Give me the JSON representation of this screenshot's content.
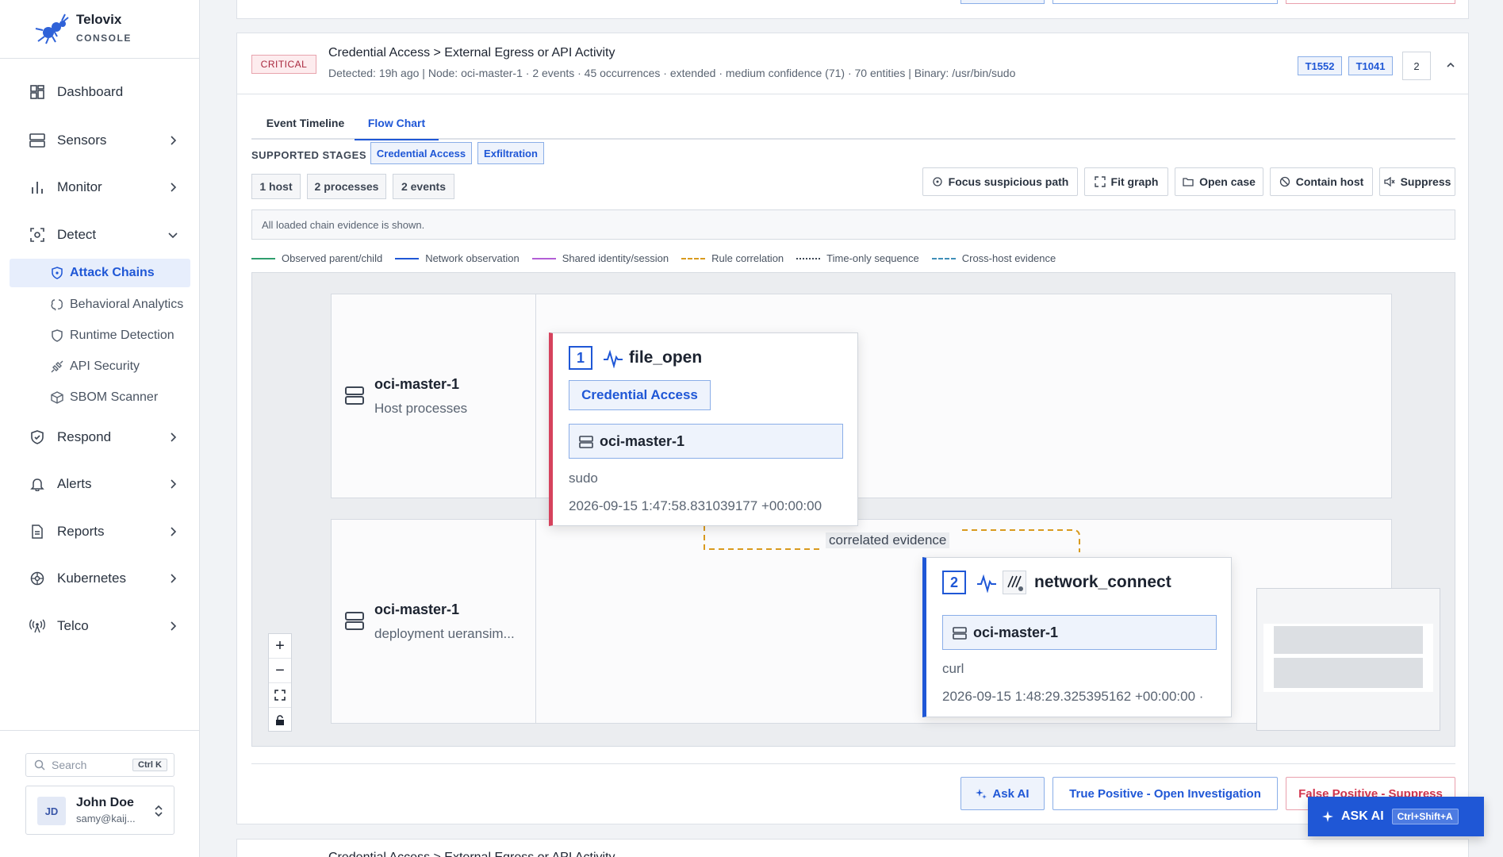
{
  "brand": {
    "name": "Telovix",
    "sub": "CONSOLE"
  },
  "nav": {
    "dashboard": "Dashboard",
    "sensors": "Sensors",
    "monitor": "Monitor",
    "detect": "Detect",
    "detect_sub": [
      "Attack Chains",
      "Behavioral Analytics",
      "Runtime Detection",
      "API Security",
      "SBOM Scanner"
    ],
    "respond": "Respond",
    "alerts": "Alerts",
    "reports": "Reports",
    "kubernetes": "Kubernetes",
    "telco": "Telco"
  },
  "search": {
    "placeholder": "Search",
    "shortcut": "Ctrl K"
  },
  "user": {
    "initials": "JD",
    "name": "John Doe",
    "email": "samy@kaij..."
  },
  "alert": {
    "severity": "CRITICAL",
    "title": "Credential Access > External Egress or API Activity",
    "meta": "Detected: 19h ago | Node: oci-master-1 · 2 events · 45 occurrences · extended · medium confidence (71) · 70 entities | Binary: /usr/bin/sudo",
    "techniques": [
      "T1552",
      "T1041"
    ],
    "count": "2"
  },
  "tabs": [
    "Event Timeline",
    "Flow Chart"
  ],
  "stages": {
    "label": "SUPPORTED STAGES",
    "items": [
      "Credential Access",
      "Exfiltration"
    ]
  },
  "stats": [
    "1 host",
    "2 processes",
    "2 events"
  ],
  "actions": [
    "Focus suspicious path",
    "Fit graph",
    "Open case",
    "Contain host",
    "Suppress"
  ],
  "info": "All loaded chain evidence is shown.",
  "legend": [
    {
      "label": "Observed parent/child",
      "color": "#2f9e6e",
      "style": "solid"
    },
    {
      "label": "Network observation",
      "color": "#1f57d6",
      "style": "solid"
    },
    {
      "label": "Shared identity/session",
      "color": "#b35fd6",
      "style": "solid"
    },
    {
      "label": "Rule correlation",
      "color": "#d99a1e",
      "style": "dashed"
    },
    {
      "label": "Time-only sequence",
      "color": "#3d4654",
      "style": "dotted"
    },
    {
      "label": "Cross-host evidence",
      "color": "#3f8fb8",
      "style": "dashed"
    }
  ],
  "lanes": [
    {
      "name": "oci-master-1",
      "sub": "Host processes"
    },
    {
      "name": "oci-master-1",
      "sub": "deployment ueransim..."
    }
  ],
  "nodes": [
    {
      "num": "1",
      "title": "file_open",
      "stage": "Credential Access",
      "host": "oci-master-1",
      "process": "sudo",
      "timestamp": "2026-09-15 1:47:58.831039177 +00:00:00"
    },
    {
      "num": "2",
      "title": "network_connect",
      "host": "oci-master-1",
      "process": "curl",
      "timestamp": "2026-09-15 1:48:29.325395162 +00:00:00 · "
    }
  ],
  "edge_label": "correlated evidence",
  "footer": {
    "ask": "Ask AI",
    "tp": "True Positive - Open Investigation",
    "fp": "False Positive - Suppress"
  },
  "next_title": "Credential Access > External Egress or API Activity",
  "ask_float": {
    "label": "ASK AI",
    "shortcut": "Ctrl+Shift+A"
  }
}
